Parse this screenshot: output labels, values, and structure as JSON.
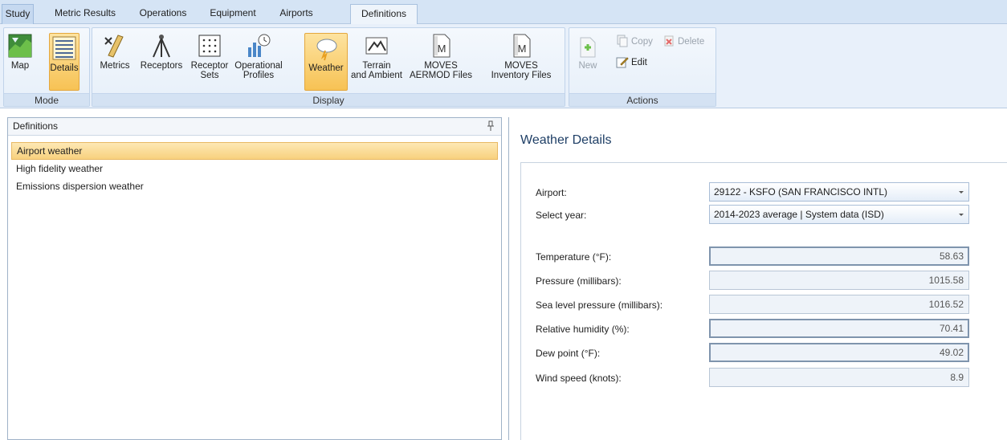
{
  "tabs": [
    {
      "label": "Study"
    },
    {
      "label": "Metric Results"
    },
    {
      "label": "Operations"
    },
    {
      "label": "Equipment"
    },
    {
      "label": "Airports"
    },
    {
      "label": "Definitions"
    }
  ],
  "ribbon": {
    "mode": {
      "label": "Mode",
      "map": "Map",
      "details": "Details"
    },
    "display": {
      "label": "Display",
      "metrics": "Metrics",
      "receptors": "Receptors",
      "receptor_sets_1": "Receptor",
      "receptor_sets_2": "Sets",
      "operational_1": "Operational",
      "operational_2": "Profiles",
      "weather": "Weather",
      "terrain_1": "Terrain",
      "terrain_2": "and Ambient",
      "aermod_1": "MOVES",
      "aermod_2": "AERMOD Files",
      "inventory_1": "MOVES",
      "inventory_2": "Inventory Files"
    },
    "actions": {
      "label": "Actions",
      "new": "New",
      "copy": "Copy",
      "delete": "Delete",
      "edit": "Edit"
    }
  },
  "definitions_panel": {
    "title": "Definitions",
    "items": [
      "Airport weather",
      "High fidelity weather",
      "Emissions dispersion weather"
    ]
  },
  "weather_details": {
    "title": "Weather Details",
    "airport_label": "Airport:",
    "airport_value": "29122 - KSFO (SAN FRANCISCO INTL)",
    "year_label": "Select year:",
    "year_value": "2014-2023 average | System data (ISD)",
    "fields": [
      {
        "label": "Temperature (°F):",
        "value": "58.63"
      },
      {
        "label": "Pressure (millibars):",
        "value": "1015.58"
      },
      {
        "label": "Sea level pressure (millibars):",
        "value": "1016.52"
      },
      {
        "label": "Relative humidity (%):",
        "value": "70.41"
      },
      {
        "label": "Dew point (°F):",
        "value": "49.02"
      },
      {
        "label": "Wind speed (knots):",
        "value": "8.9"
      }
    ]
  }
}
